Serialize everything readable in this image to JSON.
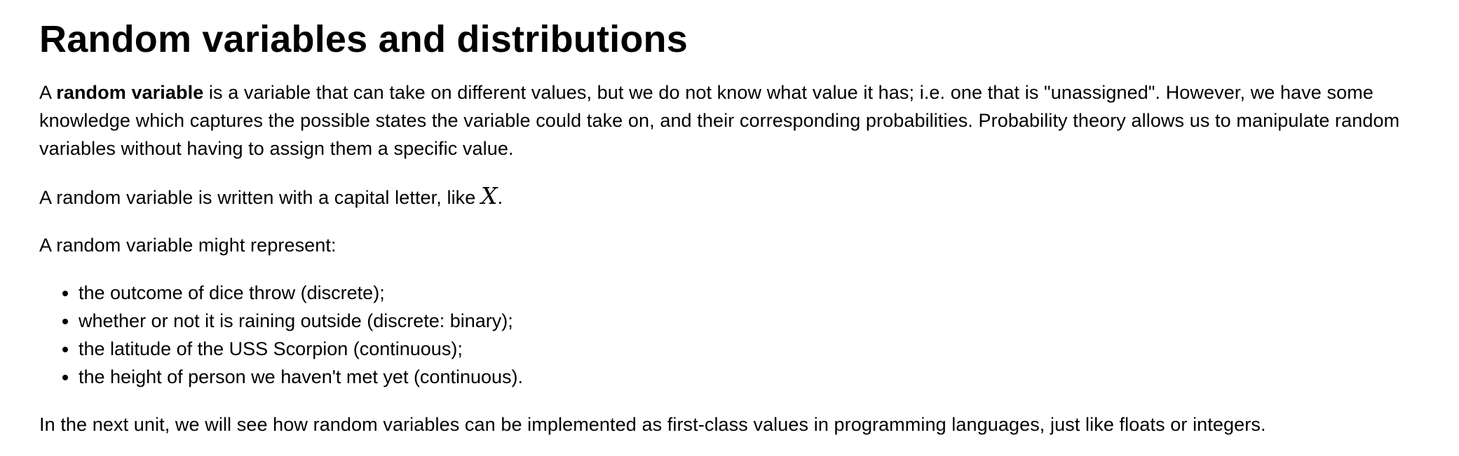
{
  "heading": "Random variables and distributions",
  "intro": {
    "prefix": "A ",
    "term": "random variable",
    "rest": " is a variable that can take on different values, but we do not know what value it has; i.e. one that is \"unassigned\". However, we have some knowledge which captures the possible states the variable could take on, and their corresponding probabilities. Probability theory allows us to manipulate random variables without having to assign them a specific value."
  },
  "notation": {
    "text": "A random variable is written with a capital letter, like ",
    "symbol": "X",
    "suffix": "."
  },
  "represent_label": "A random variable might represent:",
  "examples": [
    "the outcome of dice throw (discrete);",
    "whether or not it is raining outside (discrete: binary);",
    "the latitude of the USS Scorpion (continuous);",
    "the height of person we haven't met yet (continuous)."
  ],
  "next_unit": "In the next unit, we will see how random variables can be implemented as first-class values in programming languages, just like floats or integers."
}
